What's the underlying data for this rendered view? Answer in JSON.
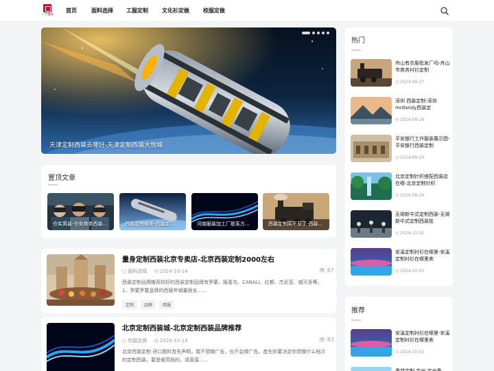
{
  "header": {
    "logo_text": "一丁服饰",
    "nav": [
      "首页",
      "面料选择",
      "工服定制",
      "文化衫定做",
      "校服定做"
    ]
  },
  "hero": {
    "caption": "天津定制西装去哪好-天津定制西装大悦城"
  },
  "pinned": {
    "title": "置顶文章",
    "items": [
      "仓实男装-仓安商务西装...",
      "西装定制哪里-西装定...",
      "河南服装加工厂联系方...",
      "西装定制买不反了-西装..."
    ]
  },
  "articles": [
    {
      "title": "量身定制西装北京专卖店-北京西装定制2000左右",
      "category": "面料选择",
      "date": "2024-10-14",
      "views": "67",
      "excerpt": "西装定制品牌推荐较好的西装定制品牌有罗蒙、报喜鸟、CANALI、红都、杰尼亚、威可多等。1、罗蒙罗蒙品牌的西服年销量居全......",
      "tags": [
        "定制",
        "品牌",
        "西服"
      ]
    },
    {
      "title": "北京定制西装城-北京定制西装品牌推荐",
      "category": "校服定做",
      "date": "2024-10-14",
      "views": "83",
      "excerpt": "北京西装定制 进口面料首先声明，我不想做广告，也不会做广告。首先你要决定你想做什么档次的定制西装，要是做高档的，请直接......"
    }
  ],
  "hot": {
    "title": "热门",
    "items": [
      {
        "title": "舟山有衣服批发厂吗-舟山市商务衬衫定制",
        "date": "2024-09-27"
      },
      {
        "title": "深圳 西装定制-深圳mrdandy西装定",
        "date": "2024-09-28"
      },
      {
        "title": "平安银行工作服装展示图-平安银行西装定制",
        "date": "2024-09-29"
      },
      {
        "title": "北京定制针织搭配西装店在哪-北京定制针织",
        "date": "2024-09-29"
      },
      {
        "title": "无锡新中式定制西装-无锡新中式定制西装批",
        "date": "2024-10-02"
      },
      {
        "title": "安溪定制衬衫在哪里-安溪定制衬衫在哪里卖",
        "date": "2024-10-02"
      }
    ]
  },
  "recommend": {
    "title": "推荐",
    "items": [
      {
        "title": "安溪定制衬衫在哪里-安溪定制衬衫在哪里卖",
        "date": "2024-10-02"
      },
      {
        "title": "贵邦定制 定州 定州贵",
        "date": ""
      }
    ]
  }
}
